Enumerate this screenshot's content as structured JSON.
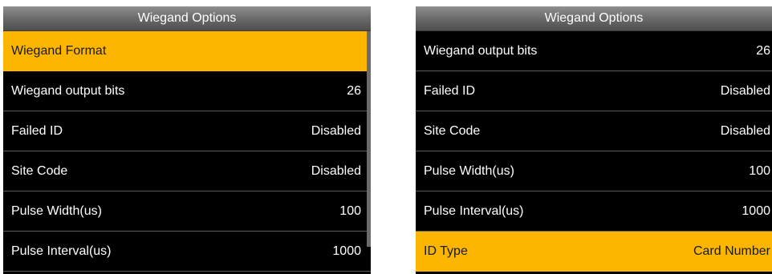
{
  "left_screen": {
    "title": "Wiegand Options",
    "items": [
      {
        "label": "Wiegand Format",
        "value": ""
      },
      {
        "label": "Wiegand output bits",
        "value": "26"
      },
      {
        "label": "Failed ID",
        "value": "Disabled"
      },
      {
        "label": "Site Code",
        "value": "Disabled"
      },
      {
        "label": "Pulse Width(us)",
        "value": "100"
      },
      {
        "label": "Pulse Interval(us)",
        "value": "1000"
      }
    ],
    "selected_item": "Wiegand Format"
  },
  "right_screen": {
    "title": "Wiegand Options",
    "items": [
      {
        "label": "Wiegand output bits",
        "value": "26"
      },
      {
        "label": "Failed ID",
        "value": "Disabled"
      },
      {
        "label": "Site Code",
        "value": "Disabled"
      },
      {
        "label": "Pulse Width(us)",
        "value": "100"
      },
      {
        "label": "Pulse Interval(us)",
        "value": "1000"
      },
      {
        "label": "ID Type",
        "value": "Card Number"
      }
    ],
    "selected_item": "ID Type"
  },
  "colors": {
    "highlight": "#fdb600",
    "background": "#000000",
    "text": "#ffffff"
  }
}
